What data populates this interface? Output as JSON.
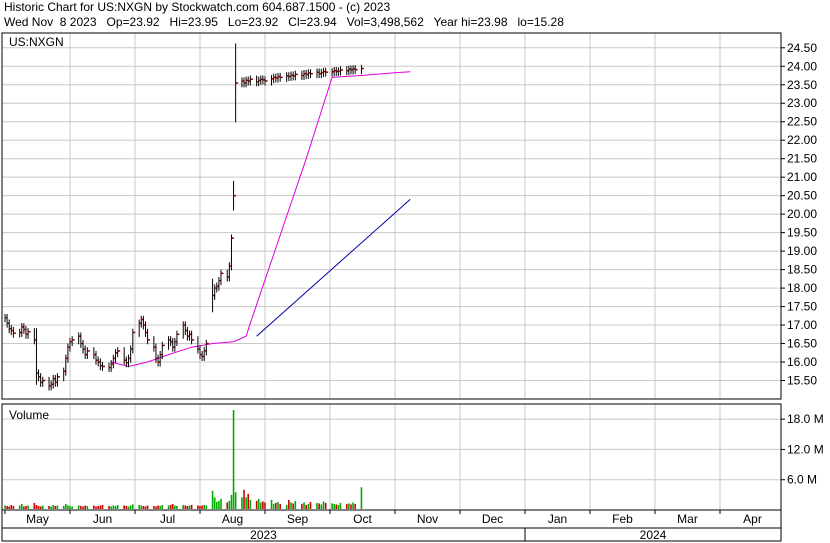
{
  "header": {
    "line1": "Historic Chart for US:NXGN by Stockwatch.com 604.687.1500 - (c) 2023",
    "line2": "Wed Nov  8 2023   Op=23.92   Hi=23.95   Lo=23.92   Cl=23.94   Vol=3,498,562   Year hi=23.98   lo=15.28"
  },
  "colors": {
    "background": "#ffffff",
    "grid": "#c8c8c8",
    "price_bar": "#8b0000",
    "ma_short": "#e000e0",
    "ma_long": "#0000aa",
    "volume_up": "#00aa00",
    "volume_down": "#cc0000"
  },
  "chart_data": [
    {
      "type": "ohlc",
      "label": "US:NXGN",
      "ylim": [
        15.0,
        24.9
      ],
      "y_ticks": [
        "15.50",
        "16.00",
        "16.50",
        "17.00",
        "17.50",
        "18.00",
        "18.50",
        "19.00",
        "19.50",
        "20.00",
        "20.50",
        "21.00",
        "21.50",
        "22.00",
        "22.50",
        "23.00",
        "23.50",
        "24.00",
        "24.50"
      ],
      "x_ticks": [
        "May",
        "Jun",
        "Jul",
        "Aug",
        "Sep",
        "Oct",
        "Nov",
        "Dec",
        "Jan",
        "Feb",
        "Mar",
        "Apr"
      ],
      "year_labels": [
        "2023",
        "2024"
      ],
      "grid": true,
      "trading_days_start": "2023-05-01",
      "daily_close": [
        17.2,
        17.05,
        16.9,
        16.85,
        16.78,
        16.8,
        16.95,
        16.88,
        16.75,
        16.82,
        16.6,
        15.7,
        15.6,
        15.45,
        15.5,
        15.35,
        15.4,
        15.55,
        15.45,
        15.6,
        15.75,
        16.1,
        16.4,
        16.55,
        16.6,
        16.7,
        16.5,
        16.35,
        16.2,
        16.3,
        16.2,
        16.05,
        16.0,
        15.9,
        15.88,
        15.85,
        15.95,
        16.1,
        16.25,
        16.3,
        16.05,
        15.98,
        16.1,
        16.35,
        16.8,
        17.05,
        17.15,
        17.0,
        16.8,
        16.6,
        16.4,
        16.1,
        16.0,
        16.2,
        16.45,
        16.6,
        16.55,
        16.4,
        16.55,
        16.75,
        17.0,
        16.85,
        16.7,
        16.75,
        16.6,
        16.35,
        16.2,
        16.15,
        16.3,
        16.5,
        17.8,
        18.0,
        18.05,
        18.2,
        18.4,
        18.3,
        18.6,
        19.35,
        20.5,
        23.55,
        23.6,
        23.55,
        23.62,
        23.6,
        23.65,
        23.58,
        23.62,
        23.65,
        23.63,
        23.6,
        23.66,
        23.7,
        23.68,
        23.72,
        23.7,
        23.74,
        23.72,
        23.76,
        23.74,
        23.78,
        23.75,
        23.8,
        23.78,
        23.82,
        23.8,
        23.84,
        23.8,
        23.83,
        23.86,
        23.84,
        23.85,
        23.88,
        23.86,
        23.87,
        23.9,
        23.88,
        23.92,
        23.9,
        23.93,
        23.91,
        23.94
      ],
      "ma_short_points": [
        [
          "2023-06-20",
          16.0
        ],
        [
          "2023-06-28",
          15.88
        ],
        [
          "2023-07-07",
          16.0
        ],
        [
          "2023-07-17",
          16.2
        ],
        [
          "2023-07-28",
          16.4
        ],
        [
          "2023-08-07",
          16.5
        ],
        [
          "2023-08-17",
          16.55
        ],
        [
          "2023-08-23",
          16.7
        ],
        [
          "2023-08-25",
          17.05
        ],
        [
          "2023-09-20",
          21.5
        ],
        [
          "2023-10-02",
          23.7
        ],
        [
          "2023-10-16",
          23.75
        ],
        [
          "2023-10-31",
          23.82
        ],
        [
          "2023-11-08",
          23.85
        ]
      ],
      "ma_long_points": [
        [
          "2023-08-28",
          16.7
        ],
        [
          "2023-11-08",
          20.4
        ]
      ]
    },
    {
      "type": "bar",
      "label": "Volume",
      "ylim": [
        0,
        21.0
      ],
      "y_ticks": [
        "6.0 M",
        "12.0 M",
        "18.0 M"
      ],
      "daily_volume_m": [
        0.9,
        0.8,
        0.7,
        1.0,
        0.8,
        0.9,
        1.2,
        0.7,
        0.8,
        0.9,
        1.4,
        1.0,
        0.8,
        0.7,
        0.9,
        0.8,
        0.7,
        1.0,
        0.8,
        0.9,
        0.8,
        1.2,
        0.9,
        0.8,
        0.7,
        0.9,
        0.8,
        0.7,
        0.9,
        0.8,
        0.9,
        0.7,
        0.8,
        0.9,
        1.0,
        0.8,
        0.7,
        0.9,
        0.8,
        1.0,
        0.9,
        0.8,
        0.7,
        0.9,
        1.1,
        1.0,
        0.9,
        0.8,
        0.7,
        0.9,
        0.8,
        0.7,
        0.9,
        0.8,
        1.0,
        0.9,
        1.0,
        1.2,
        0.9,
        0.8,
        1.0,
        0.9,
        0.8,
        0.9,
        1.0,
        0.9,
        0.8,
        0.9,
        1.0,
        0.9,
        3.8,
        2.5,
        1.6,
        1.8,
        2.2,
        1.5,
        1.8,
        3.0,
        19.8,
        3.5,
        2.5,
        4.0,
        2.5,
        3.2,
        2.0,
        1.8,
        2.2,
        1.5,
        1.7,
        1.5,
        2.0,
        1.2,
        1.4,
        1.6,
        1.2,
        1.0,
        2.0,
        1.5,
        1.3,
        1.8,
        1.2,
        1.5,
        1.0,
        1.2,
        1.6,
        1.4,
        1.3,
        1.1,
        1.7,
        1.4,
        1.3,
        1.2,
        1.1,
        1.0,
        1.4,
        1.2,
        1.3,
        1.1,
        1.5,
        1.2,
        4.5
      ]
    }
  ]
}
